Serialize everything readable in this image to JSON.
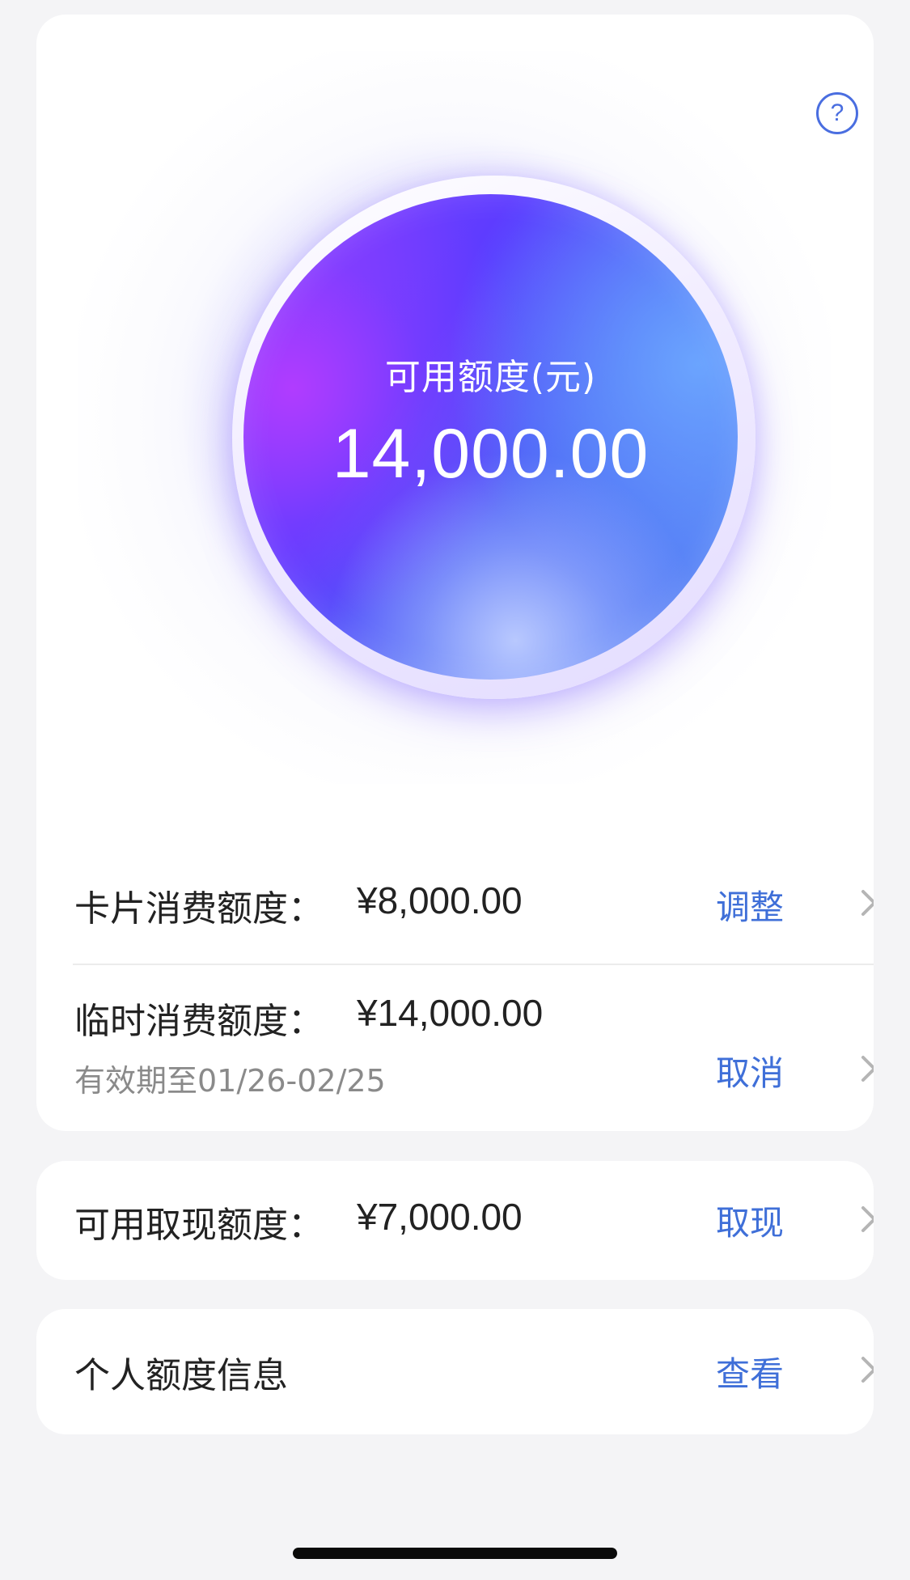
{
  "hero": {
    "label": "可用额度(元)",
    "amount": "14,000.00",
    "help_symbol": "?"
  },
  "rows": {
    "card_spend": {
      "label": "卡片消费额度：",
      "value": "¥8,000.00",
      "action": "调整"
    },
    "temp_spend": {
      "label": "临时消费额度：",
      "value": "¥14,000.00",
      "sub": "有效期至01/26-02/25",
      "action": "取消"
    },
    "cash": {
      "label": "可用取现额度：",
      "value": "¥7,000.00",
      "action": "取现"
    },
    "info": {
      "label": "个人额度信息",
      "action": "查看"
    }
  },
  "icons": {
    "help": "question-circle-icon",
    "chevron": "chevron-right-icon"
  },
  "colors": {
    "accent": "#3f6fd8",
    "orb_start": "#8f40ff",
    "orb_end": "#5a8cf5"
  }
}
